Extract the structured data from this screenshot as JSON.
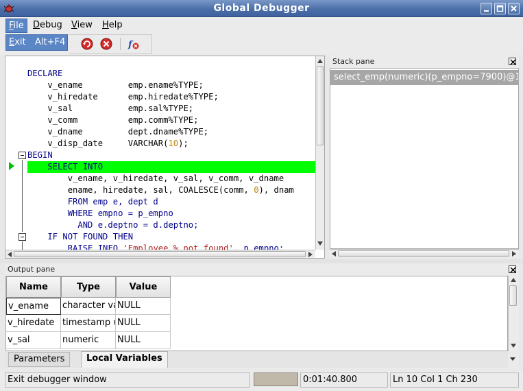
{
  "window": {
    "title": "Global Debugger"
  },
  "menubar": {
    "items": [
      {
        "label": "File",
        "underline": "F",
        "rest": "ile"
      },
      {
        "label": "Debug",
        "underline": "D",
        "rest": "ebug"
      },
      {
        "label": "View",
        "underline": "V",
        "rest": "iew"
      },
      {
        "label": "Help",
        "underline": "H",
        "rest": "elp"
      }
    ],
    "file_menu": {
      "exit_label": "Exit",
      "exit_underline": "E",
      "exit_rest": "xit",
      "exit_accel": "Alt+F4"
    }
  },
  "toolbar": {
    "buttons": [
      "restart-icon",
      "stop-icon",
      "clear-breakpoints-icon"
    ]
  },
  "code": {
    "current_line_index": 8,
    "lines": [
      "",
      "DECLARE",
      "    v_ename         emp.ename%TYPE;",
      "    v_hiredate      emp.hiredate%TYPE;",
      "    v_sal           emp.sal%TYPE;",
      "    v_comm          emp.comm%TYPE;",
      "    v_dname         dept.dname%TYPE;",
      "    v_disp_date     VARCHAR(10);",
      "BEGIN",
      "    SELECT INTO",
      "        v_ename, v_hiredate, v_sal, v_comm, v_dname",
      "        ename, hiredate, sal, COALESCE(comm, 0), dnam",
      "        FROM emp e, dept d",
      "        WHERE empno = p_empno",
      "          AND e.deptno = d.deptno;",
      "    IF NOT FOUND THEN",
      "        RAISE INFO 'Employee % not found', p_empno;"
    ]
  },
  "stack_pane": {
    "title": "Stack pane",
    "items": [
      "select_emp(numeric)(p_empno=7900)@1"
    ]
  },
  "output_pane": {
    "title": "Output pane",
    "columns": [
      "Name",
      "Type",
      "Value"
    ],
    "rows": [
      {
        "name": "v_ename",
        "type": "character va",
        "value": "NULL"
      },
      {
        "name": "v_hiredate",
        "type": "timestamp w",
        "value": "NULL"
      },
      {
        "name": "v_sal",
        "type": "numeric",
        "value": "NULL"
      }
    ],
    "tabs": [
      "Parameters",
      "Local Variables"
    ],
    "active_tab": "Local Variables"
  },
  "statusbar": {
    "message": "Exit debugger window",
    "elapsed": "0:01:40.800",
    "position": "Ln 10 Col 1 Ch 230"
  }
}
